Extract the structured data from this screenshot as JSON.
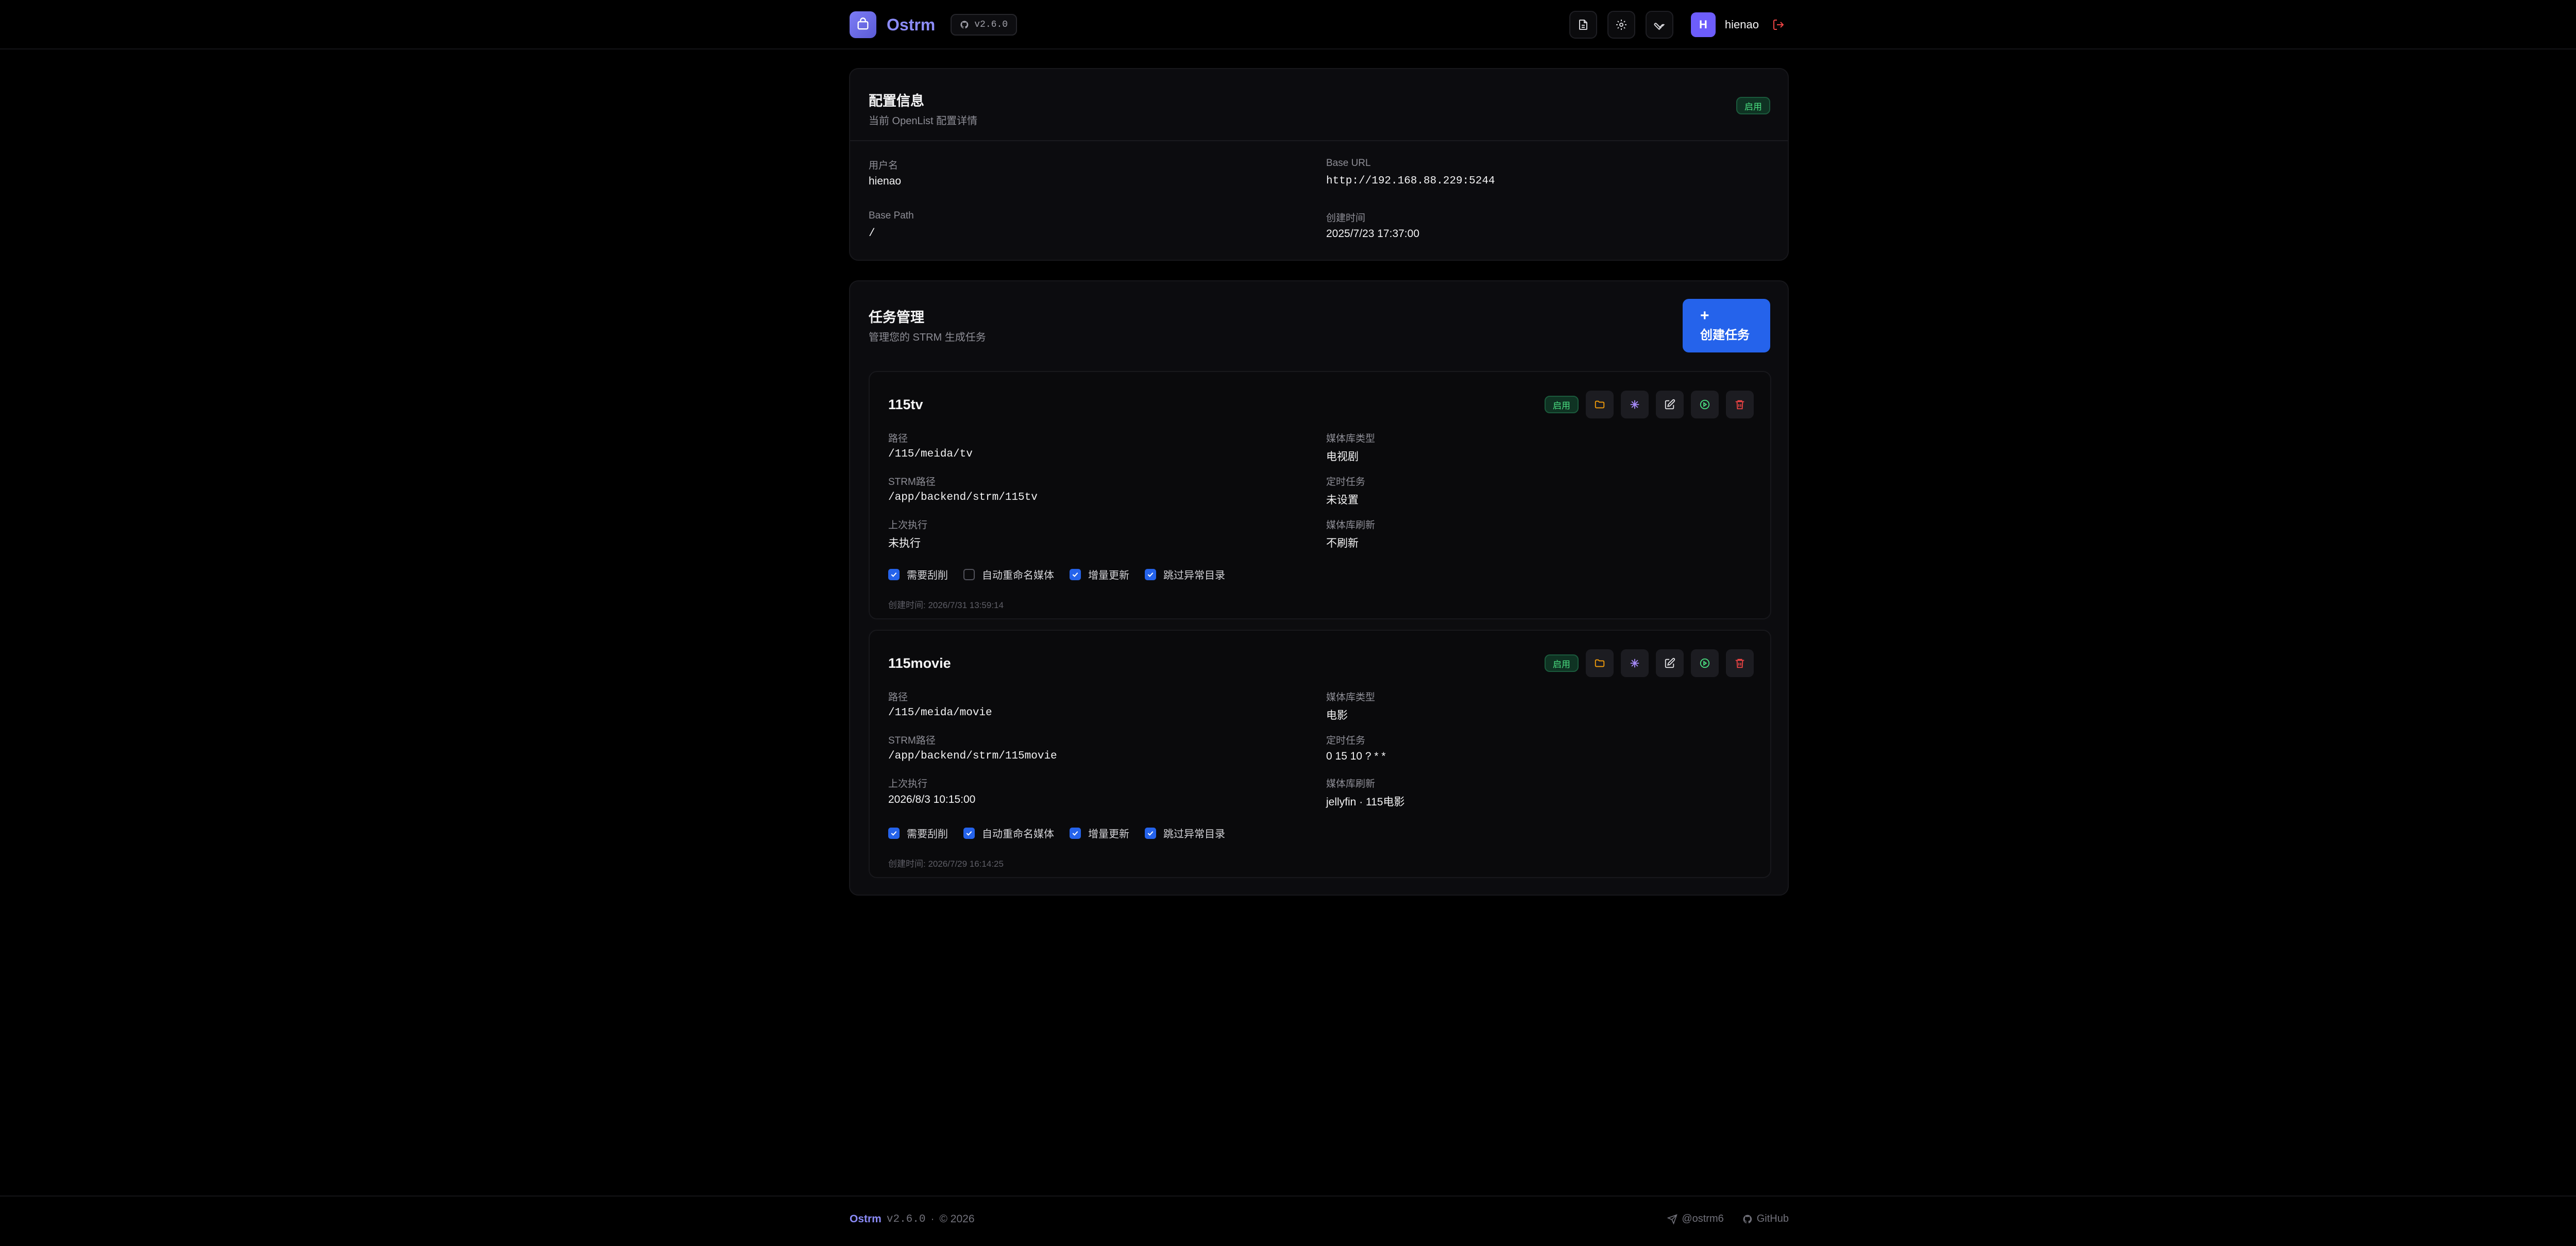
{
  "app": {
    "name": "Ostrm",
    "version": "v2.6.0"
  },
  "header": {
    "user_initial": "H",
    "user_name": "hienao"
  },
  "config": {
    "title": "配置信息",
    "subtitle": "当前 OpenList 配置详情",
    "status": "启用",
    "fields": [
      {
        "label": "用户名",
        "value": "hienao"
      },
      {
        "label": "Base URL",
        "value": "http://192.168.88.229:5244"
      },
      {
        "label": "Base Path",
        "value": "/"
      },
      {
        "label": "创建时间",
        "value": "2025/7/23 17:37:00"
      }
    ]
  },
  "tasks": {
    "title": "任务管理",
    "subtitle": "管理您的 STRM 生成任务",
    "create_plus": "+",
    "create_label": "创建任务",
    "items": [
      {
        "name": "115tv",
        "status": "启用",
        "labels": [
          "路径",
          "STRM路径",
          "上次执行",
          "媒体库类型",
          "定时任务",
          "媒体库刷新"
        ],
        "values": [
          "/115/meida/tv",
          "/app/backend/strm/115tv",
          "未执行",
          "电视剧",
          "未设置",
          "不刷新"
        ],
        "options": [
          {
            "label": "需要刮削",
            "checked": true
          },
          {
            "label": "自动重命名媒体",
            "checked": false
          },
          {
            "label": "增量更新",
            "checked": true
          },
          {
            "label": "跳过异常目录",
            "checked": true
          }
        ],
        "created": "创建时间: 2026/7/31 13:59:14"
      },
      {
        "name": "115movie",
        "status": "启用",
        "labels": [
          "路径",
          "STRM路径",
          "上次执行",
          "媒体库类型",
          "定时任务",
          "媒体库刷新"
        ],
        "values": [
          "/115/meida/movie",
          "/app/backend/strm/115movie",
          "2026/8/3 10:15:00",
          "电影",
          "0 15 10 ? * *",
          "jellyfin · 115电影"
        ],
        "options": [
          {
            "label": "需要刮削",
            "checked": true
          },
          {
            "label": "自动重命名媒体",
            "checked": true
          },
          {
            "label": "增量更新",
            "checked": true
          },
          {
            "label": "跳过异常目录",
            "checked": true
          }
        ],
        "created": "创建时间: 2026/7/29 16:14:25"
      }
    ]
  },
  "footer": {
    "brand": "Ostrm",
    "version": "v2.6.0",
    "dot": "·",
    "copyright": "© 2026",
    "telegram": "@ostrm6",
    "github": "GitHub"
  },
  "colors": {
    "accent": "#8b8bf8",
    "primary_button": "#2563eb",
    "success": "#4ade80",
    "danger": "#ef4444",
    "background": "#000000"
  }
}
